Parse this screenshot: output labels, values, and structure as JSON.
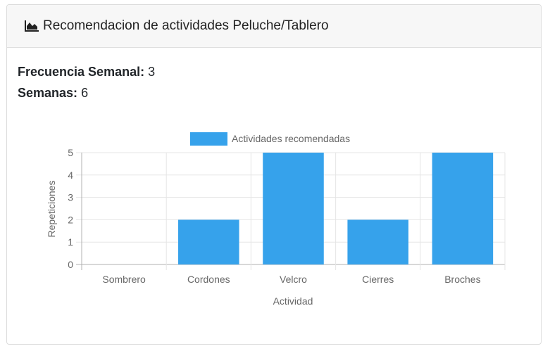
{
  "header": {
    "title": "Recomendacion de actividades Peluche/Tablero",
    "icon": "area-chart-icon"
  },
  "info": {
    "frequency_label": "Frecuencia Semanal:",
    "frequency_value": "3",
    "weeks_label": "Semanas:",
    "weeks_value": "6"
  },
  "colors": {
    "bar": "#36A2EB",
    "grid": "#e5e5e5",
    "axis": "#b0b0b0",
    "text": "#666666"
  },
  "chart_data": {
    "type": "bar",
    "categories": [
      "Sombrero",
      "Cordones",
      "Velcro",
      "Cierres",
      "Broches"
    ],
    "series": [
      {
        "name": "Actividades recomendadas",
        "values": [
          0,
          2,
          5,
          2,
          5
        ]
      }
    ],
    "xlabel": "Actividad",
    "ylabel": "Repeticiones",
    "ylim": [
      0,
      5
    ],
    "yticks": [
      0,
      1,
      2,
      3,
      4,
      5
    ],
    "grid": true,
    "legend_position": "top-center"
  }
}
